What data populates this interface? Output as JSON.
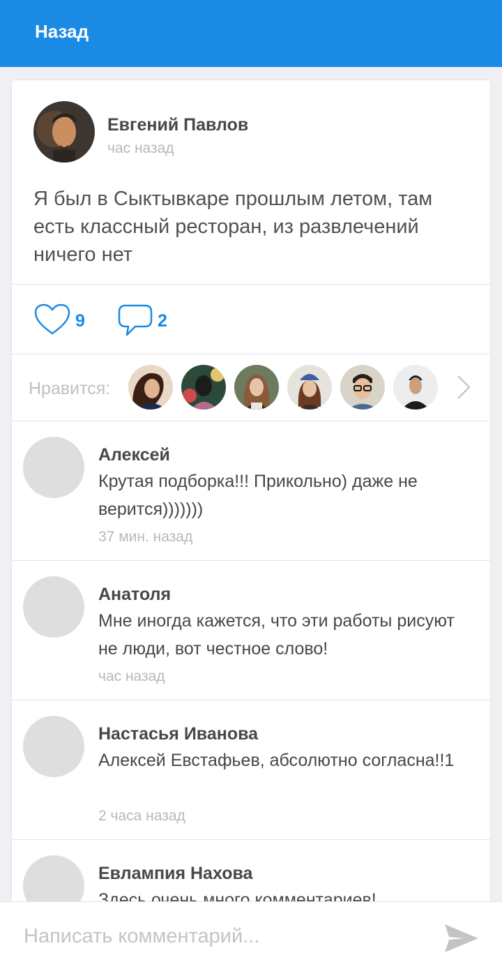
{
  "header": {
    "back_label": "Назад",
    "color": "#1a8ae4"
  },
  "post": {
    "author": "Евгений Павлов",
    "time": "час назад",
    "text": "Я был в Сыктывкаре прошлым летом, там есть классный ресторан, из развлечений ничего нет",
    "likes_count": "9",
    "comments_count": "2",
    "like_icon": "heart-outline-icon",
    "comment_icon": "speech-bubble-icon"
  },
  "likes_bar": {
    "label": "Нравится:",
    "next_icon": "chevron-right-icon"
  },
  "comments": [
    {
      "name": "Алексей",
      "text": "Крутая подборка!!! Прикольно) даже не верится)))))))",
      "time": "37 мин. назад"
    },
    {
      "name": "Анатоля",
      "text": "Мне иногда кажется, что эти работы рисуют не люди, вот честное слово!",
      "time": "час назад"
    },
    {
      "name": "Настасья Иванова",
      "text": "Алексей Евстафьев, абсолютно согласна!!1",
      "time": "2 часа назад"
    },
    {
      "name": "Евлампия Нахова",
      "text": "Здесь очень много комментариев!",
      "time": ""
    }
  ],
  "composer": {
    "placeholder": "Написать комментарий...",
    "send_icon": "send-icon"
  }
}
